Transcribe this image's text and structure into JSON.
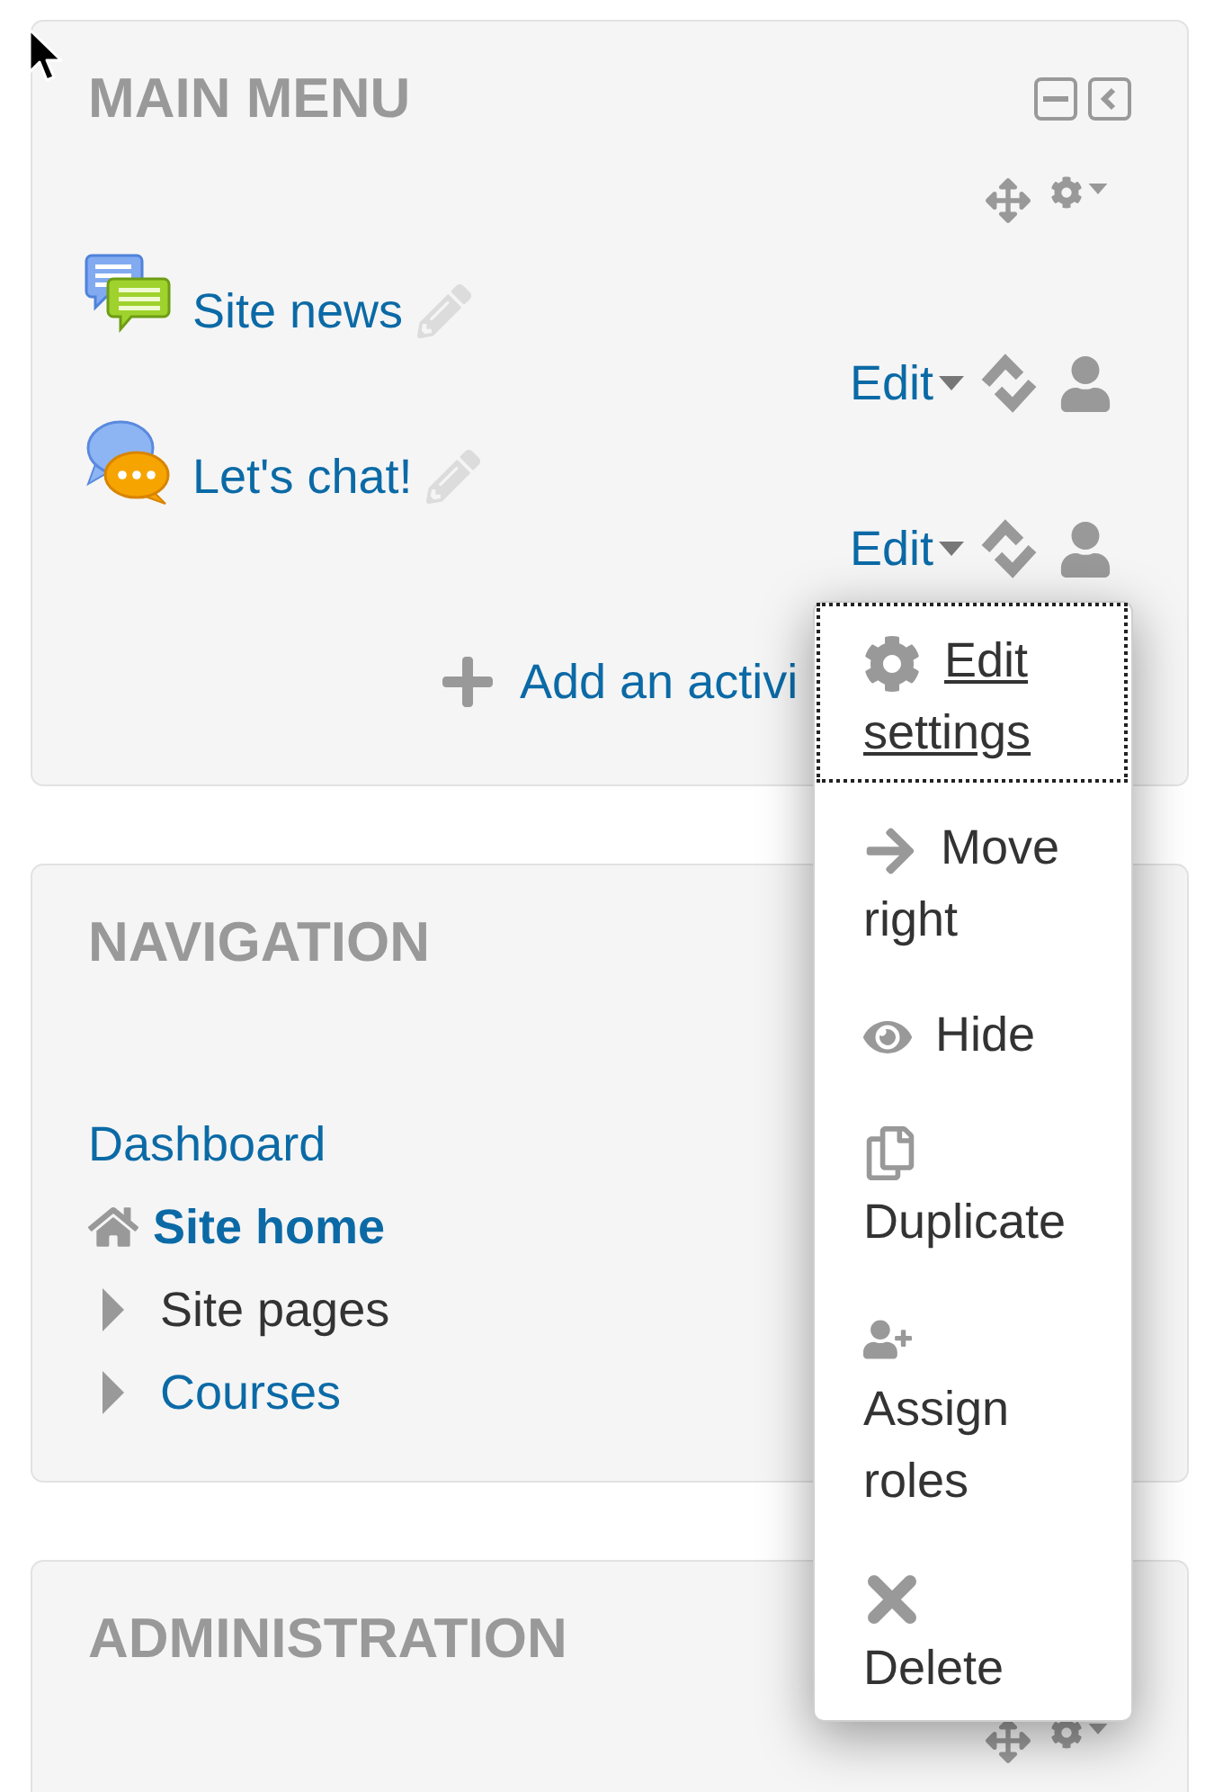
{
  "blocks": [
    {
      "title": "MAIN MENU",
      "dock_buttons": true,
      "edit_buttons": true,
      "activities": [
        {
          "kind": "forum",
          "name": "Site news",
          "edit": "Edit",
          "menu_open": false
        },
        {
          "kind": "chat",
          "name": "Let's chat!",
          "edit": "Edit",
          "menu_open": true
        }
      ],
      "add_activity": "Add an activi"
    },
    {
      "title": "NAVIGATION",
      "dock_buttons": false,
      "edit_buttons": false,
      "nav_items": [
        {
          "kind": "link",
          "label": "Dashboard",
          "link": true,
          "selected": false
        },
        {
          "kind": "home",
          "label": "Site home",
          "link": true,
          "selected": true
        },
        {
          "kind": "branch",
          "label": "Site pages",
          "link": false,
          "selected": false,
          "expanded": false
        },
        {
          "kind": "branch",
          "label": "Courses",
          "link": true,
          "selected": false,
          "expanded": false
        }
      ]
    },
    {
      "title": "ADMINISTRATION",
      "dock_buttons": false,
      "edit_buttons": true
    }
  ],
  "action_menu": {
    "items": [
      {
        "kind": "settings",
        "label": "Edit settings",
        "focused": true
      },
      {
        "kind": "move_right",
        "label": "Move right",
        "focused": false
      },
      {
        "kind": "hide",
        "label": "Hide",
        "focused": false
      },
      {
        "kind": "duplicate",
        "label": "Duplicate",
        "focused": false
      },
      {
        "kind": "assign_roles",
        "label": "Assign roles",
        "focused": false
      },
      {
        "kind": "delete",
        "label": "Delete",
        "focused": false
      }
    ]
  }
}
